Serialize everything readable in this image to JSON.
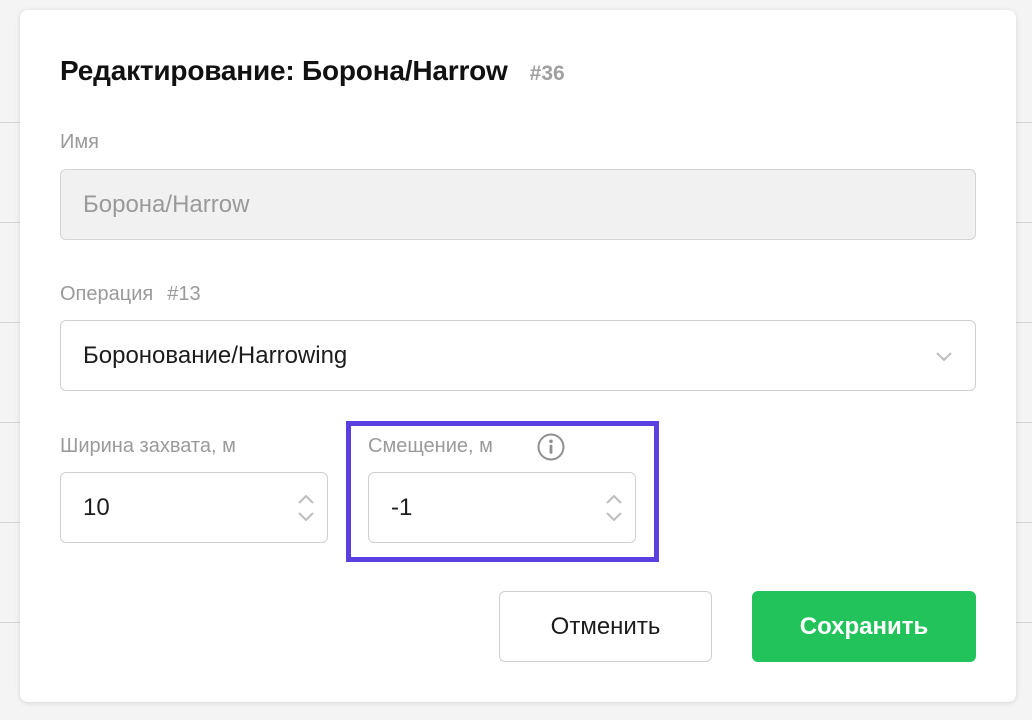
{
  "dialog": {
    "title": "Редактирование: Борона/Harrow",
    "title_id": "#36"
  },
  "name_field": {
    "label": "Имя",
    "value": "Борона/Harrow",
    "disabled": true
  },
  "operation_field": {
    "label": "Операция",
    "label_id": "#13",
    "selected": "Боронование/Harrowing"
  },
  "width_field": {
    "label": "Ширина захвата, м",
    "value": "10"
  },
  "offset_field": {
    "label": "Смещение, м",
    "value": "-1",
    "info_icon": "info-circle-icon",
    "highlighted": true
  },
  "actions": {
    "cancel_label": "Отменить",
    "save_label": "Сохранить"
  },
  "colors": {
    "save_button": "#22c35a",
    "highlight_border": "#5b3fe0",
    "label_text": "#9a9a9a"
  }
}
